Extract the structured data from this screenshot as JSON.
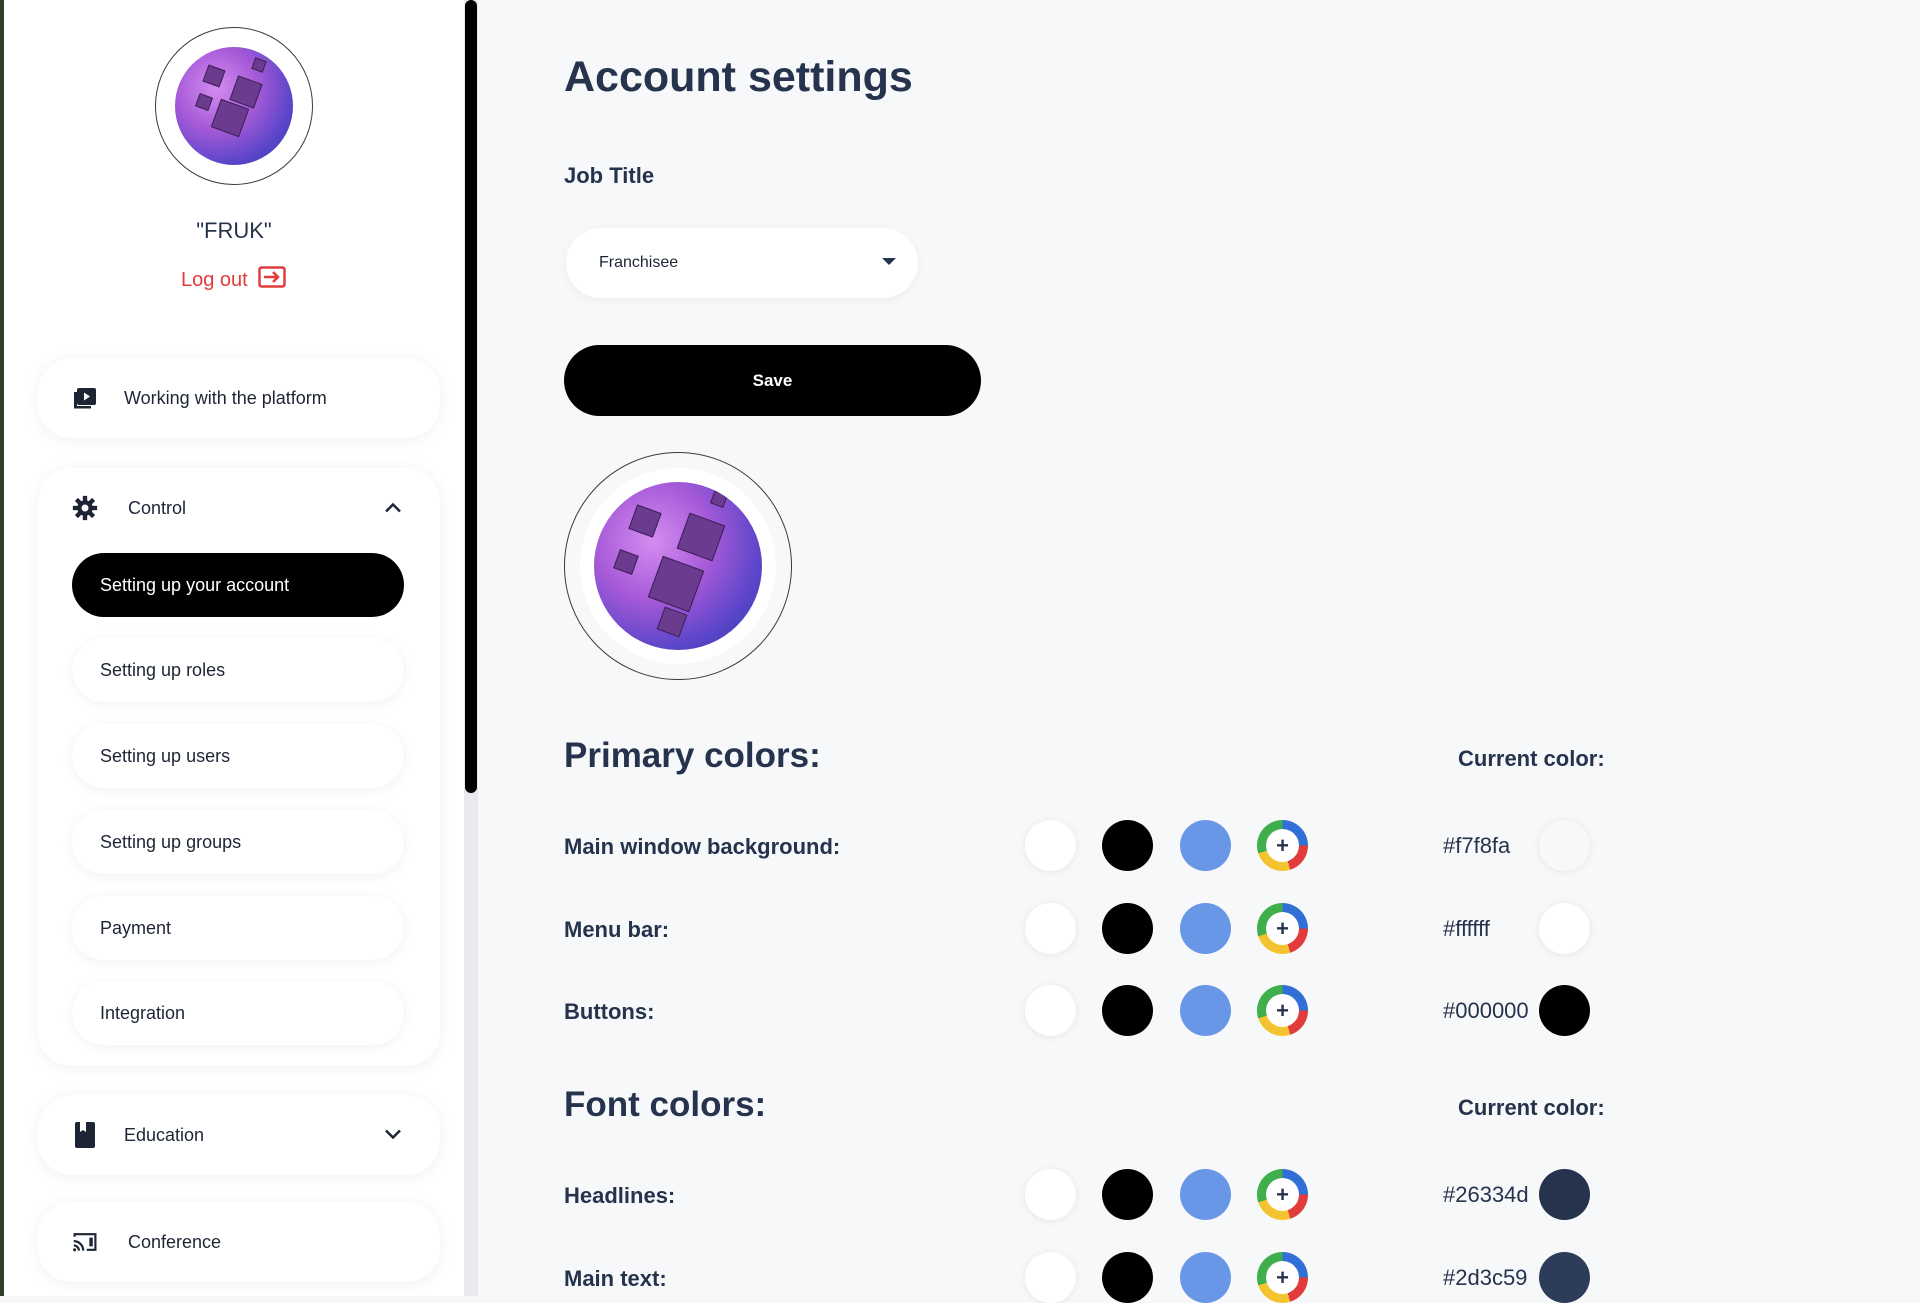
{
  "user": {
    "name": "\"FRUK\"",
    "logout_label": "Log out"
  },
  "nav": {
    "working": "Working with the platform",
    "control": "Control",
    "control_items": [
      "Setting up your account",
      "Setting up roles",
      "Setting up users",
      "Setting up groups",
      "Payment",
      "Integration"
    ],
    "education": "Education",
    "conference": "Conference"
  },
  "page": {
    "title": "Account settings",
    "job_title_label": "Job Title",
    "job_title_value": "Franchisee",
    "save_label": "Save"
  },
  "primary": {
    "title": "Primary colors:",
    "current_label": "Current color:",
    "rows": [
      {
        "label": "Main window background:",
        "hex": "#f7f8fa",
        "color": "#f7f8fa"
      },
      {
        "label": "Menu bar:",
        "hex": "#ffffff",
        "color": "#ffffff"
      },
      {
        "label": "Buttons:",
        "hex": "#000000",
        "color": "#000000"
      }
    ]
  },
  "font": {
    "title": "Font colors:",
    "current_label": "Current color:",
    "rows": [
      {
        "label": "Headlines:",
        "hex": "#26334d",
        "color": "#26334d"
      },
      {
        "label": "Main text:",
        "hex": "#2d3c59",
        "color": "#2d3c59"
      }
    ]
  },
  "preset_colors": [
    "#ffffff",
    "#000000",
    "#6797e6"
  ],
  "icons": {
    "working": "play-video-icon",
    "control": "gear-icon",
    "education": "book-icon",
    "conference": "cast-icon",
    "logout": "logout-icon",
    "picker": "color-picker-plus-icon"
  }
}
